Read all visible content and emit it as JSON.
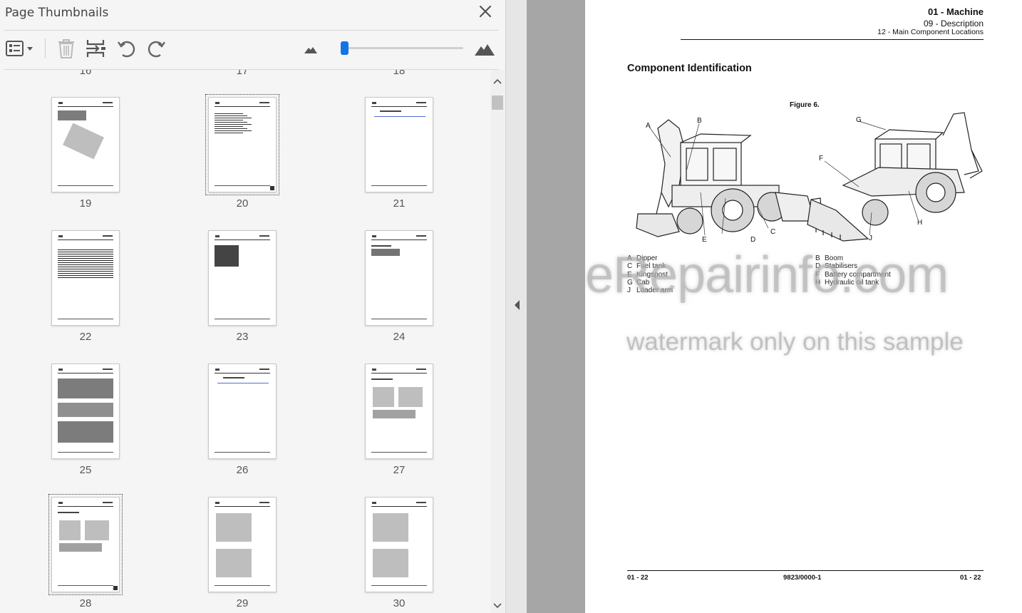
{
  "panel": {
    "title": "Page Thumbnails",
    "icons": {
      "close": "close-icon",
      "options": "list-options-icon",
      "delete": "trash-icon",
      "insert": "insert-page-icon",
      "rotate_left": "rotate-ccw-icon",
      "rotate_right": "rotate-cw-icon",
      "zoom_out": "mountain-small-icon",
      "zoom_in": "mountain-large-icon"
    },
    "thumbnail_size_slider": 0.03,
    "cut_labels": [
      "16",
      "17",
      "18"
    ],
    "thumbnails": [
      {
        "label": "19",
        "selected": false,
        "style": "figure"
      },
      {
        "label": "20",
        "selected": true,
        "style": "text-top"
      },
      {
        "label": "21",
        "selected": false,
        "style": "blue-line"
      },
      {
        "label": "22",
        "selected": false,
        "style": "lines"
      },
      {
        "label": "23",
        "selected": false,
        "style": "text-block"
      },
      {
        "label": "24",
        "selected": false,
        "style": "small-table"
      },
      {
        "label": "25",
        "selected": false,
        "style": "dense"
      },
      {
        "label": "26",
        "selected": false,
        "style": "blue-line"
      },
      {
        "label": "27",
        "selected": false,
        "style": "two-figures"
      },
      {
        "label": "28",
        "selected": true,
        "style": "two-figures-wide"
      },
      {
        "label": "29",
        "selected": false,
        "style": "figure-stack"
      },
      {
        "label": "30",
        "selected": false,
        "style": "figure-stack2"
      }
    ]
  },
  "document": {
    "header": {
      "section": "01 - Machine",
      "subsection": "09 - Description",
      "topic": "12 - Main Component Locations"
    },
    "heading": "Component Identification",
    "figure_caption": "Figure 6.",
    "callouts": [
      "A",
      "B",
      "G",
      "F",
      "E",
      "D",
      "C",
      "J",
      "H"
    ],
    "legend_left": [
      {
        "key": "A",
        "text": "Dipper"
      },
      {
        "key": "C",
        "text": "Fuel tank"
      },
      {
        "key": "E",
        "text": "Kingspost"
      },
      {
        "key": "G",
        "text": "Cab"
      },
      {
        "key": "J",
        "text": "Loader arm"
      }
    ],
    "legend_right": [
      {
        "key": "B",
        "text": "Boom"
      },
      {
        "key": "D",
        "text": "Stabilisers"
      },
      {
        "key": "F",
        "text": "Battery compartment"
      },
      {
        "key": "H",
        "text": "Hydraulic oil tank"
      }
    ],
    "watermark_main": "eRepairinfo.com",
    "watermark_sub": "watermark only on this sample",
    "footer": {
      "left": "01 - 22",
      "center": "9823/0000-1",
      "right": "01 - 22"
    }
  }
}
